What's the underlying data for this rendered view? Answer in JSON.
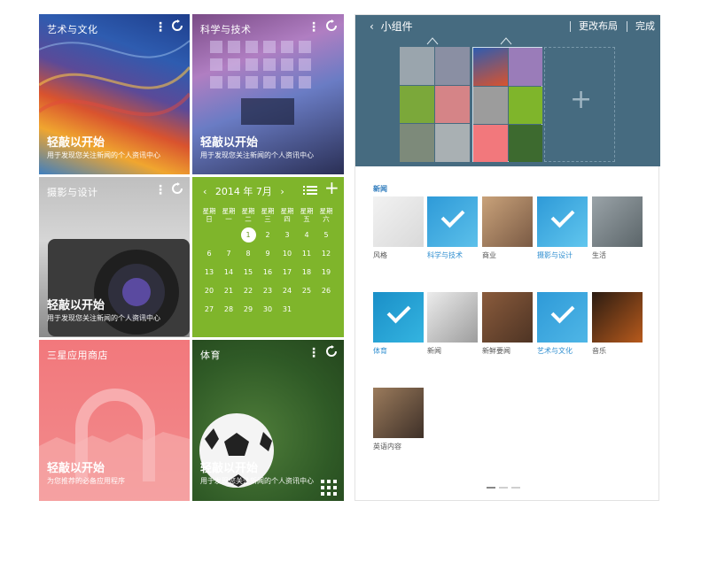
{
  "left": {
    "tiles": [
      {
        "title": "艺术与文化",
        "big": "轻敲以开始",
        "sub": "用于发现您关注新闻的个人资讯中心"
      },
      {
        "title": "科学与技术",
        "big": "轻敲以开始",
        "sub": "用于发现您关注新闻的个人资讯中心"
      },
      {
        "title": "摄影与设计",
        "big": "轻敲以开始",
        "sub": "用于发现您关注新闻的个人资讯中心"
      },
      {
        "title": "三星应用商店",
        "big": "轻敲以开始",
        "sub": "为您推荐的必备应用程序"
      },
      {
        "title": "体育",
        "big": "轻敲以开始",
        "sub": "用于发现您关注新闻的个人资讯中心"
      }
    ],
    "calendar": {
      "month": "2014 年 7月",
      "weekdays": [
        [
          "星期",
          "日"
        ],
        [
          "星期",
          "一"
        ],
        [
          "星期",
          "二"
        ],
        [
          "星期",
          "三"
        ],
        [
          "星期",
          "四"
        ],
        [
          "星期",
          "五"
        ],
        [
          "星期",
          "六"
        ]
      ],
      "days": [
        "",
        "",
        "1",
        "2",
        "3",
        "4",
        "5",
        "6",
        "7",
        "8",
        "9",
        "10",
        "11",
        "12",
        "13",
        "14",
        "15",
        "16",
        "17",
        "18",
        "19",
        "20",
        "21",
        "22",
        "23",
        "24",
        "25",
        "26",
        "27",
        "28",
        "29",
        "30",
        "31"
      ],
      "today": "1"
    }
  },
  "right": {
    "title": "小组件",
    "edit_layout": "更改布局",
    "done": "完成",
    "section": "新闻",
    "widgets": [
      {
        "label": "风格",
        "selected": false
      },
      {
        "label": "科学与技术",
        "selected": true
      },
      {
        "label": "商业",
        "selected": false
      },
      {
        "label": "摄影与设计",
        "selected": true
      },
      {
        "label": "生活",
        "selected": false
      },
      {
        "label": "体育",
        "selected": true
      },
      {
        "label": "新闻",
        "selected": false
      },
      {
        "label": "新鲜要闻",
        "selected": false
      },
      {
        "label": "艺术与文化",
        "selected": true
      },
      {
        "label": "音乐",
        "selected": false
      },
      {
        "label": "英语内容",
        "selected": false
      }
    ],
    "page_count": 3,
    "current_page": 1
  },
  "colors": {
    "accent": "#2e8ed0",
    "calendar": "#7fb52b",
    "topbar": "#466b80"
  }
}
